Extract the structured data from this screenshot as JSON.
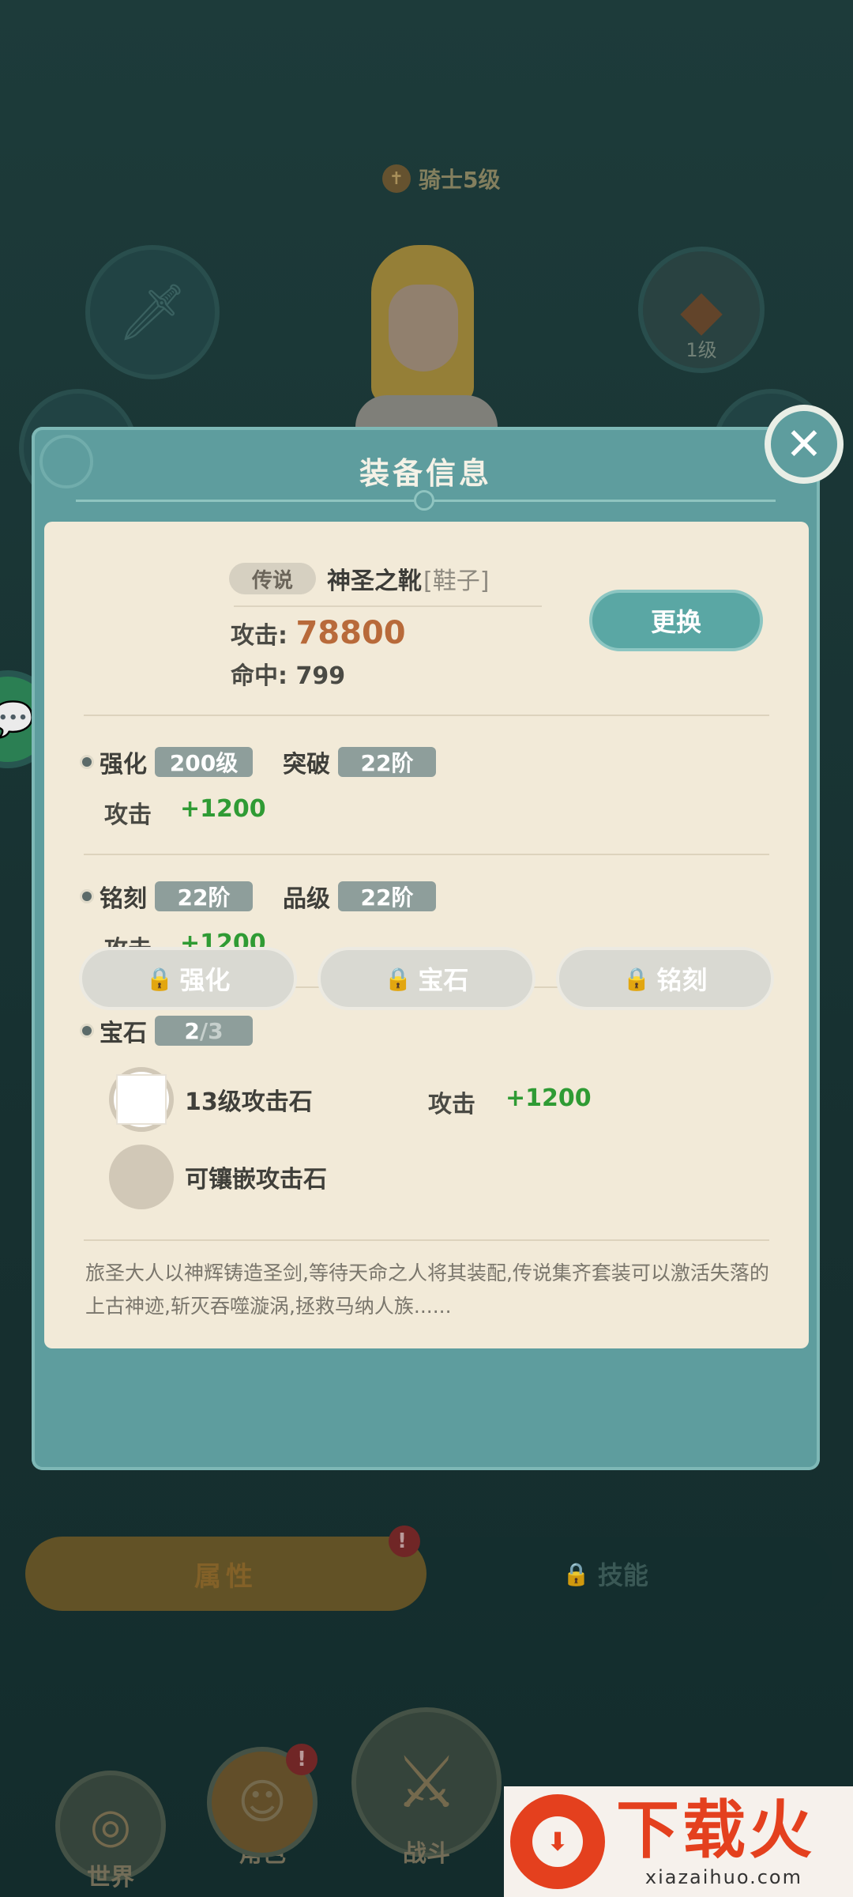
{
  "background": {
    "rank_label": "骑士5级",
    "helm_level": "1级",
    "tabs": {
      "attributes": "属性",
      "skills": "技能",
      "attributes_alert": "!"
    },
    "nav": {
      "world": "世界",
      "role": "角色",
      "battle": "战斗",
      "role_alert": "!"
    }
  },
  "dialog": {
    "title": "装备信息",
    "item": {
      "rarity": "传说",
      "name": "神圣之靴",
      "type": "[鞋子]",
      "attack_label": "攻击:",
      "attack_value": "78800",
      "hit_label": "命中:",
      "hit_value": "799"
    },
    "replace_label": "更换",
    "enhance": {
      "label": "强化",
      "level": "200级",
      "break_label": "突破",
      "break_level": "22阶",
      "bonus_label": "攻击",
      "bonus_value": "+1200"
    },
    "engrave": {
      "label": "铭刻",
      "level": "22阶",
      "grade_label": "品级",
      "grade_level": "22阶",
      "bonus_label": "攻击",
      "bonus_value": "+1200"
    },
    "gems": {
      "label": "宝石",
      "count_current": "2",
      "count_total": "/3",
      "items": [
        {
          "name": "13级攻击石",
          "stat_label": "攻击",
          "stat_value": "+1200"
        },
        {
          "name": "可镶嵌攻击石"
        }
      ]
    },
    "description": "旅圣大人以神辉铸造圣剑,等待天命之人将其装配,传说集齐套装可以激活失落的上古神迹,斩灭吞噬漩涡,拯救马纳人族......",
    "buttons": {
      "enhance": "强化",
      "gem": "宝石",
      "engrave": "铭刻"
    }
  },
  "watermark": {
    "cn": "下载火",
    "en": "xiazaihuo.com"
  },
  "colors": {
    "dialog_teal": "#5e9d9e",
    "card_bg": "#f2ead8",
    "attack_orange": "#b86a3a",
    "bonus_green": "#2f9b34",
    "watermark_red": "#e4401e"
  }
}
